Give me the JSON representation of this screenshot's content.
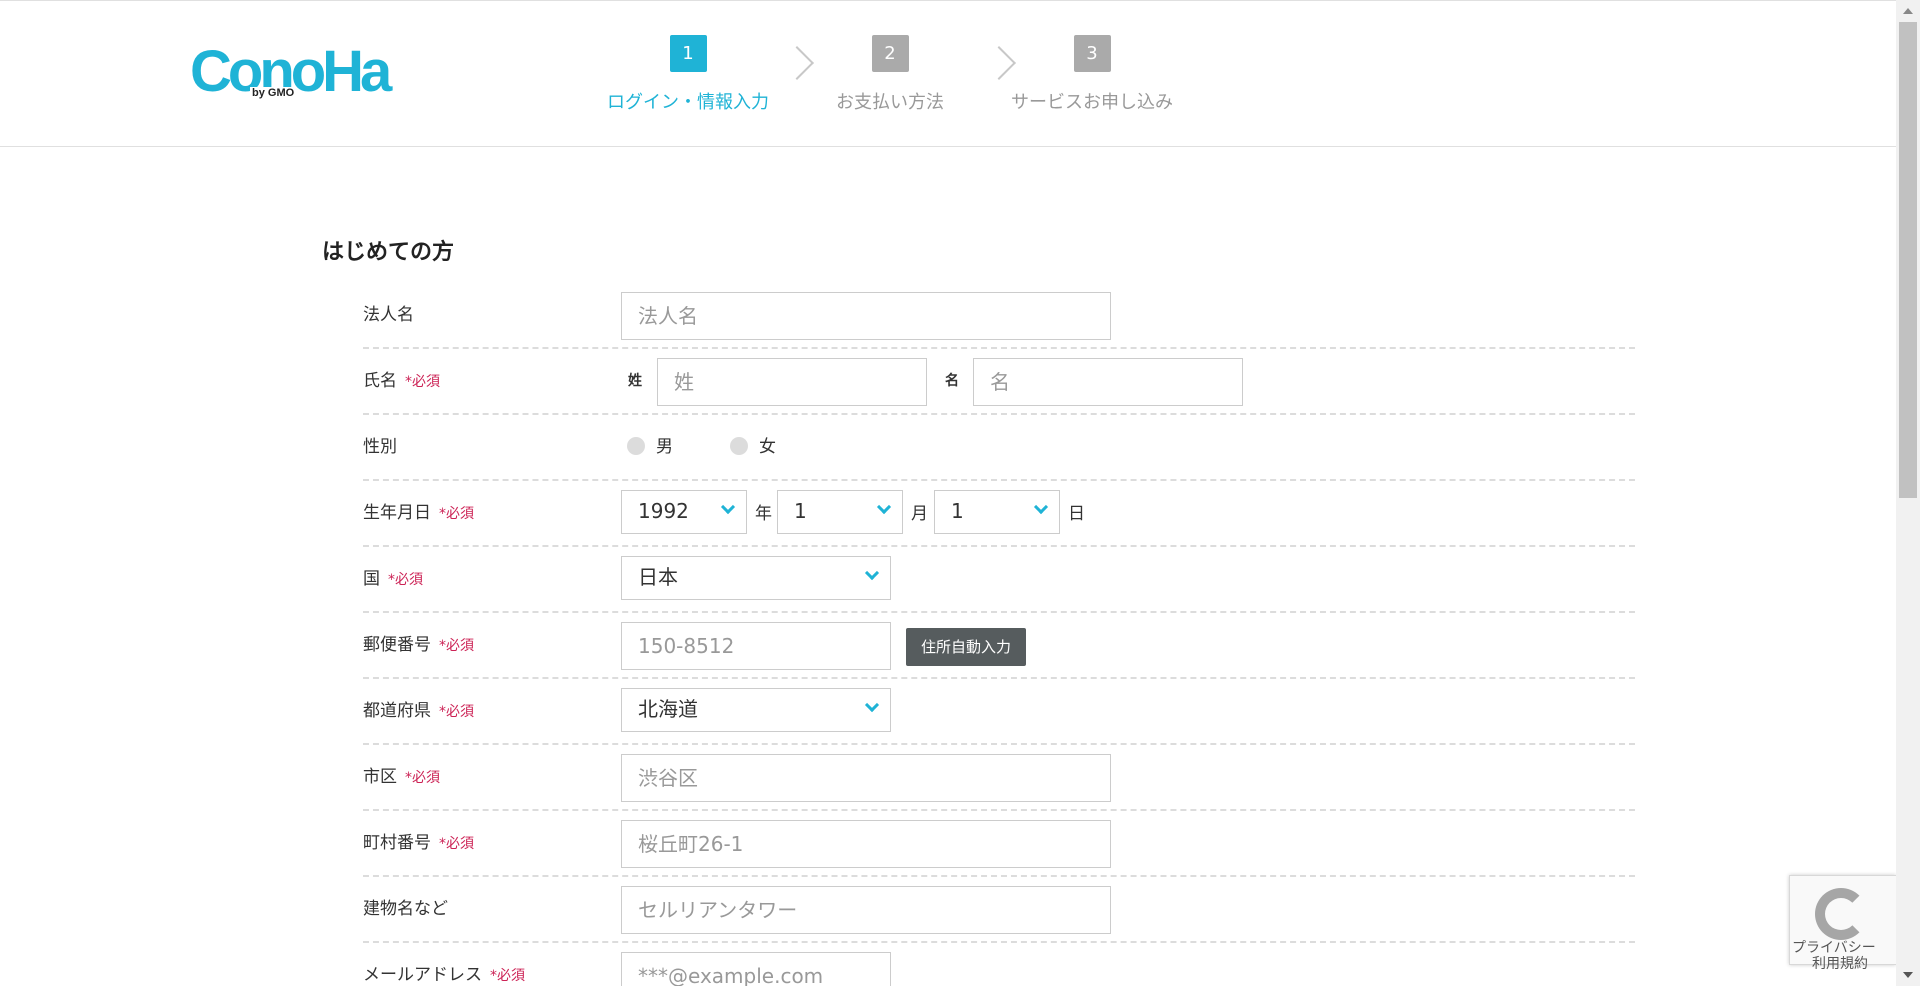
{
  "header": {
    "logo_main": "ConoHa",
    "logo_sub": "by GMO",
    "steps": [
      {
        "num": "1",
        "label": "ログイン・情報入力"
      },
      {
        "num": "2",
        "label": "お支払い方法"
      },
      {
        "num": "3",
        "label": "サービスお申し込み"
      }
    ]
  },
  "form": {
    "section_title": "はじめての方",
    "required_mark": "*必須",
    "company": {
      "label": "法人名",
      "placeholder": "法人名"
    },
    "name": {
      "label": "氏名",
      "last_label": "姓",
      "last_placeholder": "姓",
      "first_label": "名",
      "first_placeholder": "名"
    },
    "gender": {
      "label": "性別",
      "options": [
        "男",
        "女"
      ]
    },
    "birthdate": {
      "label": "生年月日",
      "year": "1992",
      "year_unit": "年",
      "month": "1",
      "month_unit": "月",
      "day": "1",
      "day_unit": "日"
    },
    "country": {
      "label": "国",
      "value": "日本"
    },
    "postal": {
      "label": "郵便番号",
      "placeholder": "150-8512",
      "button": "住所自動入力"
    },
    "prefecture": {
      "label": "都道府県",
      "value": "北海道"
    },
    "city": {
      "label": "市区",
      "placeholder": "渋谷区"
    },
    "town": {
      "label": "町村番号",
      "placeholder": "桜丘町26-1"
    },
    "building": {
      "label": "建物名など",
      "placeholder": "セルリアンタワー"
    },
    "email": {
      "label": "メールアドレス",
      "placeholder": "***@example.com"
    }
  },
  "recaptcha": {
    "privacy": "プライバシー",
    "terms": "利用規約"
  },
  "colors": {
    "accent": "#1fb3d6",
    "required": "#cc2255",
    "button": "#565c5e"
  }
}
